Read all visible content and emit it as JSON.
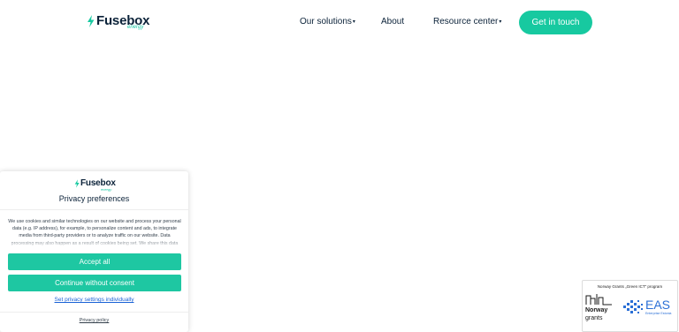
{
  "header": {
    "brand": "Fusebox",
    "brand_sub": "energy",
    "nav": [
      {
        "label": "Our solutions",
        "has_dropdown": true
      },
      {
        "label": "About",
        "has_dropdown": false
      },
      {
        "label": "Resource center",
        "has_dropdown": true
      }
    ],
    "cta_label": "Get in touch"
  },
  "cookie_dialog": {
    "brand": "Fusebox",
    "brand_sub": "energy",
    "title": "Privacy preferences",
    "body": "We use cookies and similar technologies on our website and process your personal data (e.g. IP address), for example, to personalize content and ads, to integrate media from third-party providers or to analyze traffic on our website. Data processing may also happen as a result of cookies being set. We share this data with third parties that we name in the privacy settings.",
    "accept_all_label": "Accept all",
    "continue_label": "Continue without consent",
    "settings_link": "Set privacy settings individually",
    "policy_link": "Privacy policy"
  },
  "grants_badge": {
    "title": "Norway Grants „Green ICT\" program",
    "norway": "Norway",
    "grants": "grants",
    "eas": "EAS",
    "eas_sub": "Enterprise Estonia"
  },
  "colors": {
    "accent": "#17c9a0",
    "navy": "#0b2239",
    "link": "#1a62d6"
  }
}
